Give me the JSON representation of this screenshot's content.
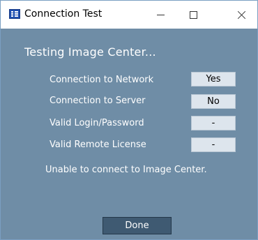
{
  "window": {
    "title": "Connection Test",
    "icon": "app-grid-icon",
    "controls": {
      "minimize": "minimize-icon",
      "maximize": "maximize-icon",
      "close": "close-icon"
    }
  },
  "main": {
    "heading": "Testing Image Center...",
    "checks": [
      {
        "label": "Connection to Network",
        "value": "Yes"
      },
      {
        "label": "Connection to Server",
        "value": "No"
      },
      {
        "label": "Valid Login/Password",
        "value": "-"
      },
      {
        "label": "Valid Remote License",
        "value": "-"
      }
    ],
    "message": "Unable to connect to Image Center.",
    "done_label": "Done"
  },
  "colors": {
    "client_background": "#6f8da6",
    "value_box": "#dde5ed",
    "button": "#3f5a72"
  }
}
